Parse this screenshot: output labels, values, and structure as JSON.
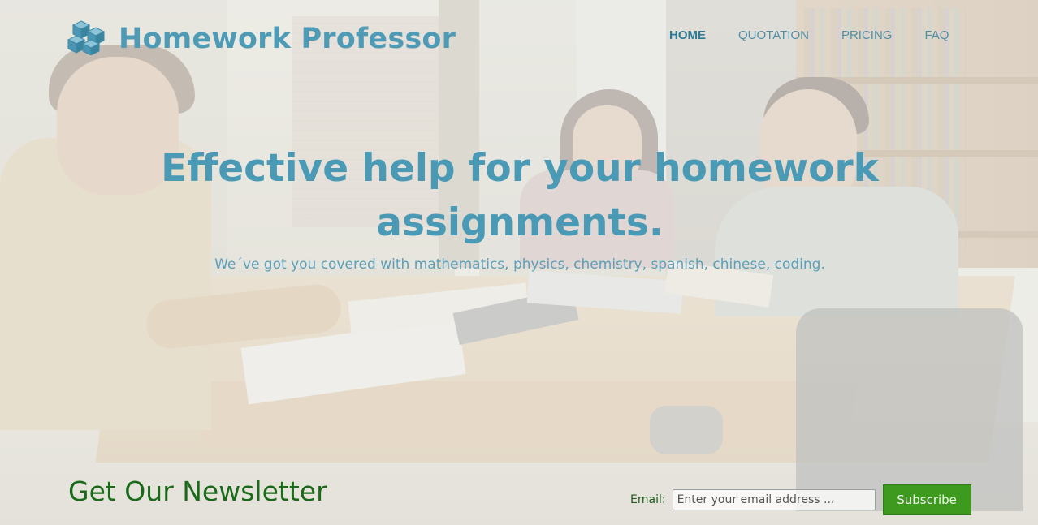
{
  "brand": {
    "name": "Homework Professor",
    "logo_icon": "cubes-icon",
    "color": "#4f9bb5"
  },
  "nav": {
    "items": [
      {
        "label": "HOME",
        "active": true
      },
      {
        "label": "QUOTATION",
        "active": false
      },
      {
        "label": "PRICING",
        "active": false
      },
      {
        "label": "FAQ",
        "active": false
      }
    ]
  },
  "hero": {
    "title": "Effective help for your homework assignments.",
    "subtitle": "We´ve got you covered with mathematics, physics, chemistry, spanish, chinese, coding."
  },
  "newsletter": {
    "heading": "Get Our Newsletter",
    "email_label": "Email:",
    "email_placeholder": "Enter your email address ...",
    "email_value": "",
    "subscribe_label": "Subscribe",
    "accent_color": "#3e9a1f"
  }
}
